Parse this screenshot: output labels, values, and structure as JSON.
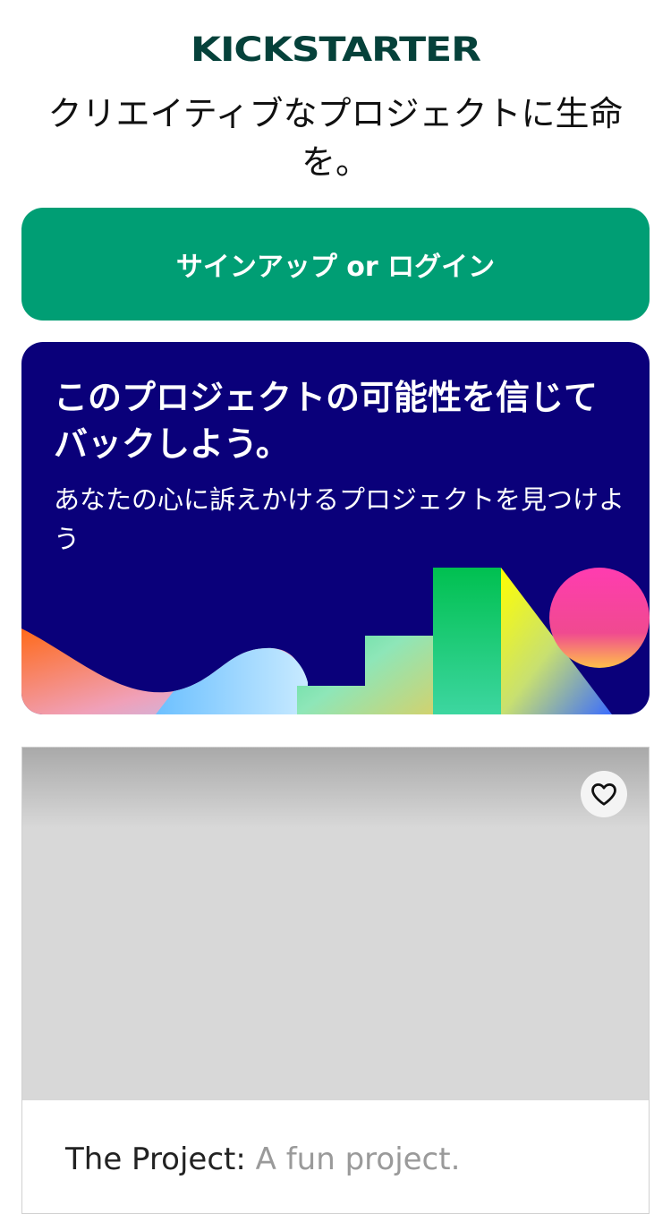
{
  "header": {
    "logo_text": "KICKSTARTER",
    "tagline": "クリエイティブなプロジェクトに生命を。"
  },
  "signup_button": {
    "label": "サインアップ or ログイン"
  },
  "promo": {
    "title": "このプロジェクトの可能性を信じてバックしよう。",
    "subtitle": "あなたの心に訴えかけるプロジェクトを見つけよう"
  },
  "project_card": {
    "name": "The Project:",
    "description": "A fun project.",
    "icon": "heart-icon"
  },
  "colors": {
    "brand_green": "#009e74",
    "logo_dark_green": "#05413a",
    "promo_navy": "#0a007a"
  }
}
